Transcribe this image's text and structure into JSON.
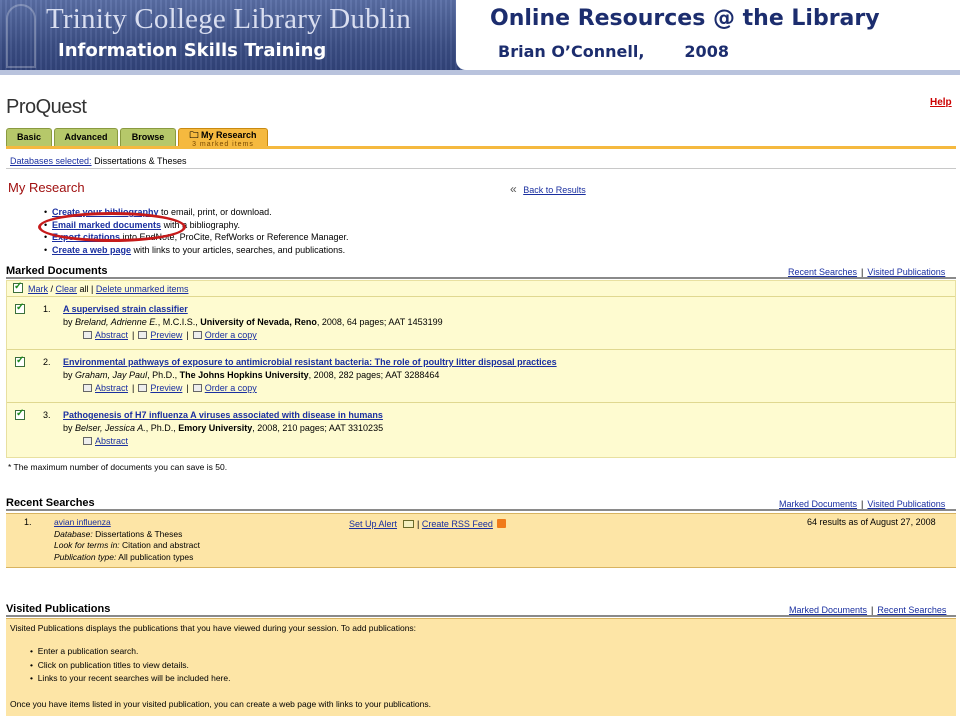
{
  "slide": {
    "library_title": "Trinity College Library Dublin",
    "subtitle": "Information Skills Training",
    "main_title": "Online Resources @ the Library",
    "author": "Brian O’Connell,",
    "year": "2008"
  },
  "proquest": {
    "logo": "ProQuest",
    "help": "Help",
    "tabs": {
      "basic": "Basic",
      "advanced": "Advanced",
      "browse": "Browse",
      "my_research": "My Research",
      "my_research_sub": "3 marked items"
    },
    "databases_label": "Databases selected:",
    "databases_value": "Dissertations & Theses",
    "page_title": "My Research",
    "back_chevron": "«",
    "back_link": "Back to Results",
    "options": [
      {
        "link": "Create your bibliography",
        "rest": "to email, print, or download."
      },
      {
        "link": "Email marked documents",
        "rest": "with a bibliography."
      },
      {
        "link": "Export citations",
        "rest": "into EndNote, ProCite, RefWorks or Reference Manager."
      },
      {
        "link": "Create a web page",
        "rest": "with links to your articles, searches, and publications."
      }
    ],
    "marked": {
      "title": "Marked Documents",
      "links": [
        "Recent Searches",
        "Visited Publications"
      ],
      "mark": "Mark",
      "clear": "Clear",
      "all": "all |",
      "delete": "Delete unmarked items",
      "items": [
        {
          "num": "1.",
          "title": "A supervised strain classifier",
          "by": "by",
          "author": "Breland, Adrienne E.",
          "degree": ", M.C.I.S.,",
          "university": "University of Nevada, Reno",
          "details": ", 2008, 64 pages; AAT 1453199",
          "abstract": "Abstract",
          "preview": "Preview",
          "order": "Order a copy"
        },
        {
          "num": "2.",
          "title": "Environmental pathways of exposure to antimicrobial resistant bacteria: The role of poultry litter disposal practices",
          "by": "by",
          "author": "Graham, Jay Paul",
          "degree": ", Ph.D.,",
          "university": "The Johns Hopkins University",
          "details": ", 2008, 282 pages; AAT 3288464",
          "abstract": "Abstract",
          "preview": "Preview",
          "order": "Order a copy"
        },
        {
          "num": "3.",
          "title": "Pathogenesis of H7 influenza A viruses associated with disease in humans",
          "by": "by",
          "author": "Belser, Jessica A.",
          "degree": ", Ph.D.,",
          "university": "Emory University",
          "details": ", 2008, 210 pages; AAT 3310235",
          "abstract": "Abstract"
        }
      ],
      "note": "* The maximum number of documents you can save is 50."
    },
    "recent": {
      "title": "Recent Searches",
      "links": [
        "Marked Documents",
        "Visited Publications"
      ],
      "num": "1.",
      "query": "avian influenza",
      "database_label": "Database:",
      "database_value": "Dissertations & Theses",
      "terms_label": "Look for terms in:",
      "terms_value": "Citation and abstract",
      "pubtype_label": "Publication type:",
      "pubtype_value": "All publication types",
      "alert": "Set Up Alert",
      "rss": "Create RSS Feed",
      "count": "64 results as of August 27, 2008"
    },
    "visited": {
      "title": "Visited Publications",
      "links": [
        "Marked Documents",
        "Recent Searches"
      ],
      "intro": "Visited Publications displays the publications that you have viewed during your session. To add publications:",
      "steps": [
        "Enter a publication search.",
        "Click on publication titles to view details.",
        "Links to your recent searches will be included here."
      ],
      "footer": "Once you have items listed in your visited publication, you can create a web page with links to your publications."
    }
  },
  "colors": {
    "banner": "#4a5e93",
    "heading_navy": "#1c2d6e",
    "link_blue": "#1a2fa0",
    "tab_green": "#b6c86a",
    "tab_orange": "#f5b93f",
    "highlight_red": "#c61a1a",
    "marked_bg": "#fefbd0",
    "recent_bg": "#fde5a6"
  }
}
